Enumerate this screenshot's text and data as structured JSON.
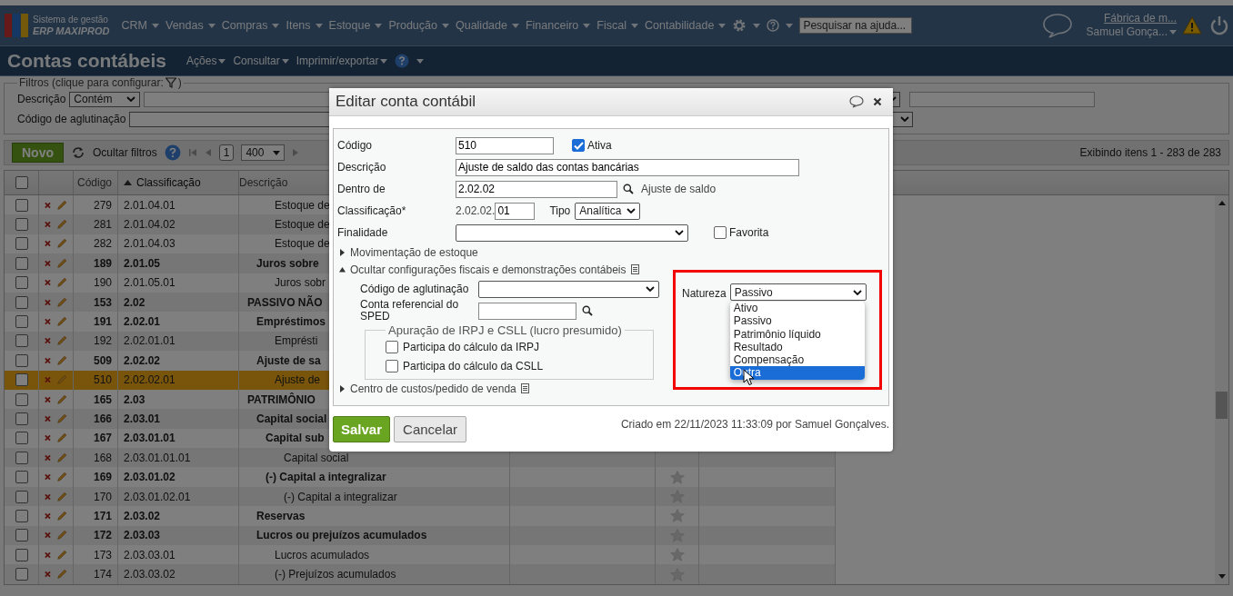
{
  "app": {
    "system_label": "Sistema de gestão",
    "product": "ERP MAXIPROD"
  },
  "menu": [
    "CRM",
    "Vendas",
    "Compras",
    "Itens",
    "Estoque",
    "Produção",
    "Qualidade",
    "Financeiro",
    "Fiscal",
    "Contabilidade"
  ],
  "help_search": {
    "placeholder": "Pesquisar na ajuda..."
  },
  "company": "Fábrica de m...",
  "user": "Samuel Gonça...",
  "page": {
    "title": "Contas contábeis",
    "actions": [
      "Ações",
      "Consultar",
      "Imprimir/exportar"
    ]
  },
  "filters": {
    "legend": "Filtros (clique para configurar:",
    "legend_end": ")",
    "description_label": "Descrição",
    "description_mode": "Contém",
    "agglutination_label": "Código de aglutinação"
  },
  "toolbar": {
    "new_button": "Novo",
    "hide_filters": "Ocultar filtros",
    "page": "1",
    "page_size": "400",
    "summary": "Exibindo itens 1 - 283 de 283"
  },
  "table": {
    "all_checked": false,
    "columns": [
      {
        "label": "Código",
        "sorted": false
      },
      {
        "label": "Classificação",
        "sorted": true
      },
      {
        "label": "Descrição",
        "sorted": false
      }
    ],
    "rows": [
      {
        "code": "279",
        "class": "2.01.04.01",
        "desc": "Estoque de",
        "kind": "analytic",
        "selected": false
      },
      {
        "code": "281",
        "class": "2.01.04.02",
        "desc": "Estoque de",
        "kind": "analytic",
        "selected": false
      },
      {
        "code": "282",
        "class": "2.01.04.03",
        "desc": "Estoque de",
        "kind": "analytic",
        "selected": false
      },
      {
        "code": "189",
        "class": "2.01.05",
        "desc": "Juros sobre",
        "kind": "synthetic",
        "selected": false
      },
      {
        "code": "190",
        "class": "2.01.05.01",
        "desc": "Juros sobr",
        "kind": "analytic",
        "selected": false
      },
      {
        "code": "153",
        "class": "2.02",
        "desc": "PASSIVO NÃO",
        "kind": "synthetic",
        "selected": false
      },
      {
        "code": "191",
        "class": "2.02.01",
        "desc": "Empréstimos",
        "kind": "synthetic",
        "selected": false
      },
      {
        "code": "192",
        "class": "2.02.01.01",
        "desc": "Emprésti",
        "kind": "analytic",
        "selected": false
      },
      {
        "code": "509",
        "class": "2.02.02",
        "desc": "Ajuste de sa",
        "kind": "synthetic",
        "selected": false
      },
      {
        "code": "510",
        "class": "2.02.02.01",
        "desc": "Ajuste de",
        "kind": "analytic",
        "selected": true
      },
      {
        "code": "165",
        "class": "2.03",
        "desc": "PATRIMÔNIO",
        "kind": "synthetic",
        "selected": false
      },
      {
        "code": "166",
        "class": "2.03.01",
        "desc": "Capital social",
        "kind": "synthetic",
        "selected": false
      },
      {
        "code": "167",
        "class": "2.03.01.01",
        "desc": "Capital sub",
        "kind": "synthetic",
        "selected": false
      },
      {
        "code": "168",
        "class": "2.03.01.01.01",
        "desc": "Capital social",
        "kind": "analytic",
        "selected": false
      },
      {
        "code": "169",
        "class": "2.03.01.02",
        "desc": "(-) Capital a integralizar",
        "kind": "synthetic",
        "selected": false,
        "favorite": false
      },
      {
        "code": "170",
        "class": "2.03.01.02.01",
        "desc": "(-) Capital a integralizar",
        "kind": "analytic",
        "selected": false,
        "favorite": false
      },
      {
        "code": "171",
        "class": "2.03.02",
        "desc": "Reservas",
        "kind": "synthetic",
        "selected": false,
        "favorite": false
      },
      {
        "code": "172",
        "class": "2.03.03",
        "desc": "Lucros ou prejuízos acumulados",
        "kind": "synthetic",
        "selected": false,
        "favorite": false
      },
      {
        "code": "173",
        "class": "2.03.03.01",
        "desc": "Lucros acumulados",
        "kind": "analytic",
        "selected": false,
        "favorite": false
      },
      {
        "code": "174",
        "class": "2.03.03.02",
        "desc": "(-) Prejuízos acumulados",
        "kind": "analytic",
        "selected": false,
        "favorite": false
      }
    ]
  },
  "dialog": {
    "title": "Editar conta contábil",
    "code_label": "Código",
    "code": "510",
    "active_label": "Ativa",
    "active": true,
    "description_label": "Descrição",
    "description": "Ajuste de saldo das contas bancárias",
    "parent_label": "Dentro de",
    "parent": "2.02.02",
    "parent_name": "Ajuste de saldo",
    "classification_label": "Classificação*",
    "classification_prefix": "2.02.02.",
    "classification_suffix": "01",
    "type_label": "Tipo",
    "type": "Analítica",
    "purpose_label": "Finalidade",
    "favorite_label": "Favorita",
    "favorite": false,
    "sections": [
      {
        "label": "Movimentação de estoque",
        "expanded": false
      },
      {
        "label": "Ocultar configurações fiscais e demonstrações contábeis",
        "expanded": true
      },
      {
        "label": "Centro de custos/pedido de venda",
        "expanded": false
      }
    ],
    "agglutination_label": "Código de aglutinação",
    "sped_label": "Conta referencial do SPED",
    "tax_group": "Apuração de IRPJ e CSLL (lucro presumido)",
    "irpj_label": "Participa do cálculo da IRPJ",
    "irpj": false,
    "csll_label": "Participa do cálculo da CSLL",
    "csll": false,
    "nature_label": "Natureza",
    "nature": "Passivo",
    "nature_options": [
      {
        "label": "Ativo",
        "selected": false
      },
      {
        "label": "Passivo",
        "selected": false
      },
      {
        "label": "Patrimônio líquido",
        "selected": false
      },
      {
        "label": "Resultado",
        "selected": false
      },
      {
        "label": "Compensação",
        "selected": false
      },
      {
        "label": "Outra",
        "selected": true
      }
    ],
    "save": "Salvar",
    "cancel": "Cancelar",
    "created": "Criado em 22/11/2023 11:33:09 por Samuel Gonçalves."
  }
}
